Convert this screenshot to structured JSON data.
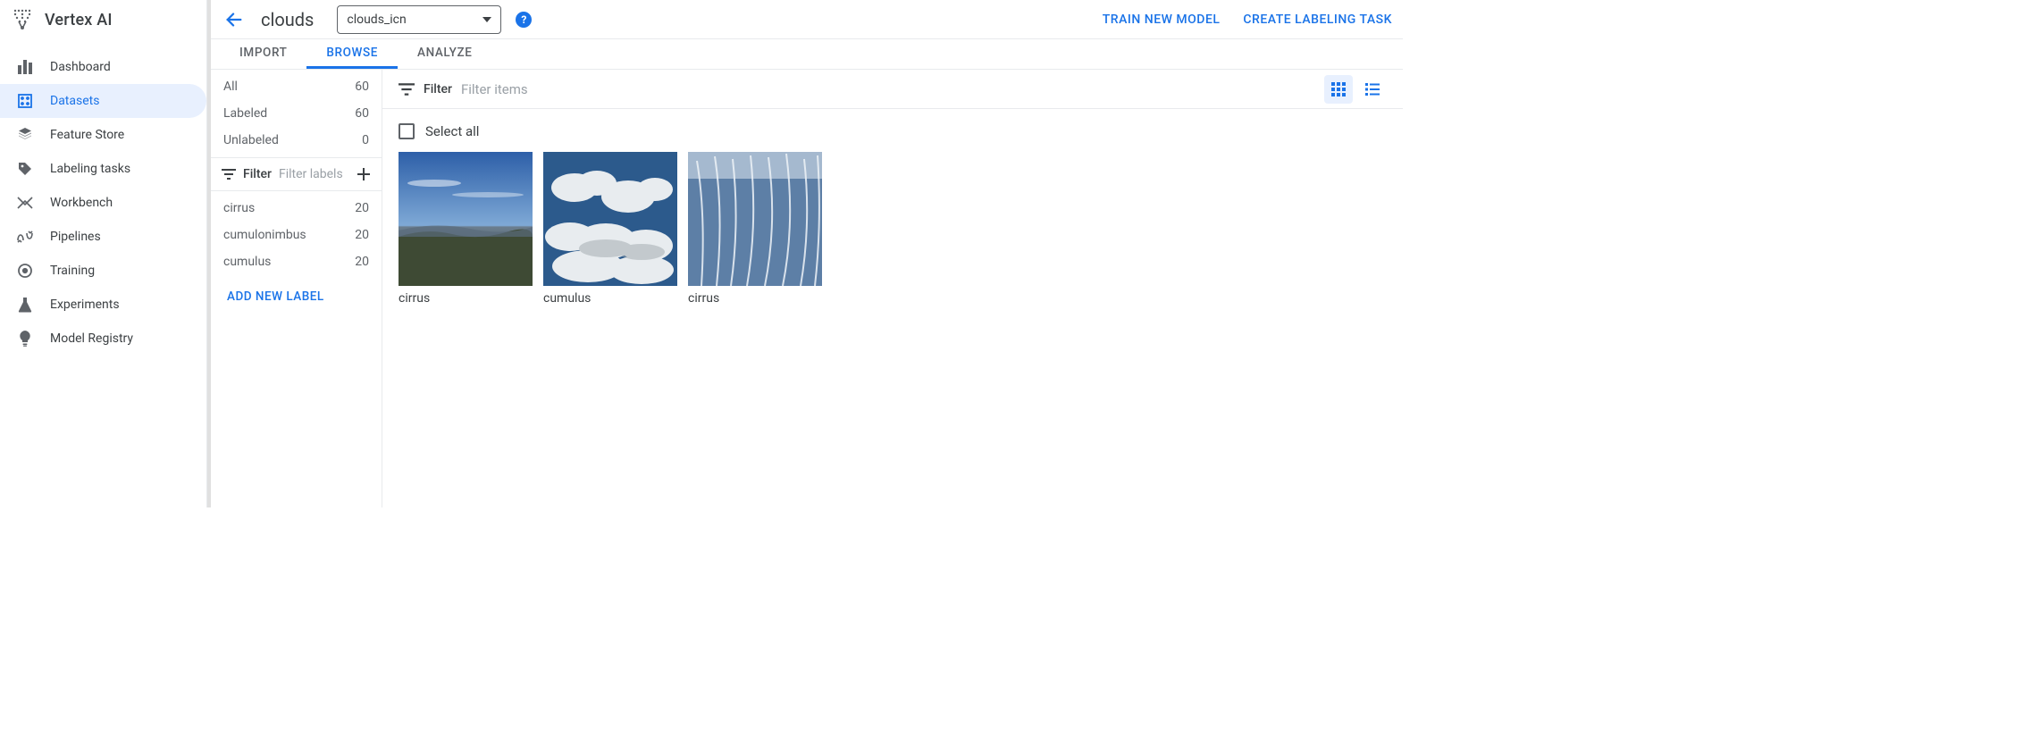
{
  "brand": {
    "title": "Vertex AI"
  },
  "sidebar": {
    "items": [
      {
        "label": "Dashboard"
      },
      {
        "label": "Datasets",
        "active": true
      },
      {
        "label": "Feature Store"
      },
      {
        "label": "Labeling tasks"
      },
      {
        "label": "Workbench"
      },
      {
        "label": "Pipelines"
      },
      {
        "label": "Training"
      },
      {
        "label": "Experiments"
      },
      {
        "label": "Model Registry"
      }
    ]
  },
  "header": {
    "title": "clouds",
    "selected_annotation_set": "clouds_icn",
    "actions": {
      "train": "TRAIN NEW MODEL",
      "labeling": "CREATE LABELING TASK"
    }
  },
  "tabs": [
    {
      "label": "IMPORT"
    },
    {
      "label": "BROWSE",
      "active": true
    },
    {
      "label": "ANALYZE"
    }
  ],
  "label_panel": {
    "summary": [
      {
        "label": "All",
        "count": "60"
      },
      {
        "label": "Labeled",
        "count": "60"
      },
      {
        "label": "Unlabeled",
        "count": "0"
      }
    ],
    "filter_label": "Filter",
    "filter_placeholder": "Filter labels",
    "labels": [
      {
        "name": "cirrus",
        "count": "20"
      },
      {
        "name": "cumulonimbus",
        "count": "20"
      },
      {
        "name": "cumulus",
        "count": "20"
      }
    ],
    "add_label": "ADD NEW LABEL"
  },
  "browse_panel": {
    "filter_label": "Filter",
    "filter_placeholder": "Filter items",
    "select_all_label": "Select all",
    "items": [
      {
        "label": "cirrus"
      },
      {
        "label": "cumulus"
      },
      {
        "label": "cirrus"
      }
    ]
  }
}
